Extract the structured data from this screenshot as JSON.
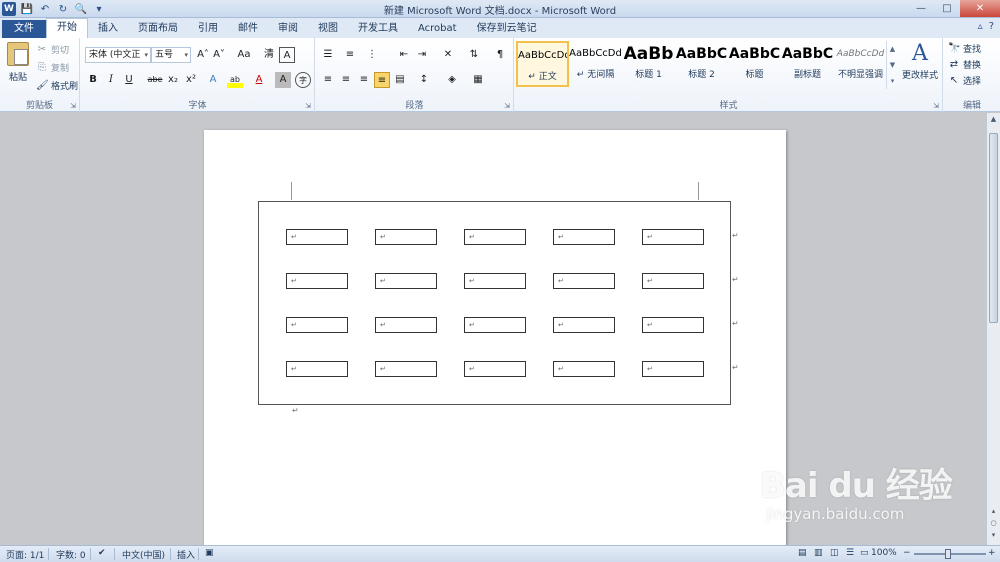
{
  "window": {
    "title": "新建 Microsoft Word 文档.docx - Microsoft Word",
    "minimize": "—",
    "maximize": "□",
    "close": "✕"
  },
  "qat": {
    "app_icon": "W",
    "save_icon": "save-icon",
    "undo_icon": "undo-icon",
    "redo_icon": "redo-icon",
    "preview_icon": "print-preview-icon",
    "customize_icon": "chevron-down-icon"
  },
  "tabs": [
    {
      "label": "文件",
      "kind": "file"
    },
    {
      "label": "开始",
      "kind": "active"
    },
    {
      "label": "插入"
    },
    {
      "label": "页面布局"
    },
    {
      "label": "引用"
    },
    {
      "label": "邮件"
    },
    {
      "label": "审阅"
    },
    {
      "label": "视图"
    },
    {
      "label": "开发工具"
    },
    {
      "label": "Acrobat"
    },
    {
      "label": "保存到云笔记"
    }
  ],
  "ribbon": {
    "clipboard": {
      "paste": "粘贴",
      "cut": "剪切",
      "copy": "复制",
      "format_painter": "格式刷",
      "label": "剪贴板"
    },
    "font": {
      "font_name": "宋体 (中文正",
      "font_size": "五号",
      "grow": "A˄",
      "shrink": "A˅",
      "change_case": "Aa",
      "clear_format": "清",
      "char_border": "A",
      "bold": "B",
      "italic": "I",
      "underline": "U",
      "strike": "abe",
      "subscript": "x₂",
      "superscript": "x²",
      "text_effect": "A",
      "highlight": "ab",
      "font_color": "A",
      "char_shading": "A",
      "enclose": "字",
      "label": "字体"
    },
    "paragraph": {
      "label": "段落"
    },
    "styles": {
      "label": "样式",
      "items": [
        {
          "preview": "AaBbCcDd",
          "name": "↵ 正文",
          "active": true
        },
        {
          "preview": "AaBbCcDd",
          "name": "↵ 无间隔"
        },
        {
          "preview": "AaBb",
          "name": "标题 1"
        },
        {
          "preview": "AaBbC",
          "name": "标题 2"
        },
        {
          "preview": "AaBbC",
          "name": "标题"
        },
        {
          "preview": "AaBbC",
          "name": "副标题"
        },
        {
          "preview": "AaBbCcDd",
          "name": "不明显强调"
        }
      ],
      "change_styles": "更改样式"
    },
    "editing": {
      "find": "查找",
      "replace": "替换",
      "select": "选择",
      "label": "编辑"
    }
  },
  "document": {
    "grid_rows": 4,
    "grid_cols": 5,
    "cell_mark": "↵",
    "para_mark": "↵"
  },
  "status": {
    "page": "页面: 1/1",
    "words": "字数: 0",
    "language": "中文(中国)",
    "mode": "插入",
    "zoom": "100%",
    "zoom_minus": "−",
    "zoom_plus": "+"
  },
  "watermark": {
    "logo": "Bai du 经验",
    "url": "jingyan.baidu.com"
  },
  "colors": {
    "accent": "#2b5797",
    "ribbon_bg": "#eef3fa",
    "workspace": "#c6c8cc",
    "active_style_border": "#f2c04b"
  }
}
